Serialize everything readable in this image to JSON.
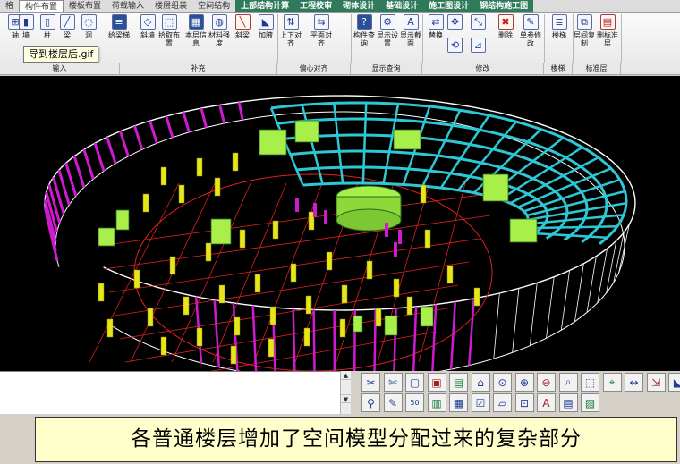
{
  "tabs": [
    "格",
    "构件布置",
    "楼板布置",
    "荷载输入",
    "楼层组装",
    "空间结构",
    "上部结构计算",
    "工程校审",
    "砌体设计",
    "基础设计",
    "施工图设计",
    "钢结构施工图"
  ],
  "active_tab_index": 1,
  "ribbon": {
    "tools": [
      {
        "label": "轴",
        "icon": "axis-icon"
      },
      {
        "label": "墙",
        "icon": "wall-icon"
      },
      {
        "label": "柱",
        "icon": "column-icon"
      },
      {
        "label": "梁",
        "icon": "beam-icon"
      },
      {
        "label": "洞",
        "icon": "opening-icon"
      },
      {
        "label": "给梁梯",
        "icon": "stair-beam-icon"
      },
      {
        "label": "斜墙",
        "icon": "slant-wall-icon"
      },
      {
        "label": "拾取布置",
        "icon": "pick-layout-icon"
      },
      {
        "label": "本层信息",
        "icon": "floor-info-icon"
      },
      {
        "label": "材料强度",
        "icon": "material-strength-icon"
      },
      {
        "label": "斜梁",
        "icon": "slant-beam-icon"
      },
      {
        "label": "加腋",
        "icon": "haunch-icon"
      },
      {
        "label": "上下对齐",
        "icon": "align-vertical-icon"
      },
      {
        "label": "平面对齐",
        "icon": "align-plane-icon"
      },
      {
        "label": "构件查询",
        "icon": "member-query-icon"
      },
      {
        "label": "显示设置",
        "icon": "display-settings-icon"
      },
      {
        "label": "显示截面",
        "icon": "display-section-icon"
      },
      {
        "label": "替换",
        "icon": "replace-icon"
      },
      {
        "label": "删除",
        "icon": "delete-icon"
      },
      {
        "label": "单参修改",
        "icon": "param-edit-icon"
      },
      {
        "label": "楼梯",
        "icon": "stairs-icon"
      },
      {
        "label": "层间复制",
        "icon": "floor-copy-icon"
      },
      {
        "label": "删标准层",
        "icon": "delete-std-floor-icon"
      }
    ],
    "groups": [
      "输入",
      "补充",
      "偏心对齐",
      "显示查询",
      "修改",
      "楼梯",
      "标准层"
    ],
    "tooltip": "导到楼层后.gif"
  },
  "colors": {
    "beams": "#2ec7d4",
    "slabs": "#a8ef4a",
    "braces": "#d01ad0",
    "columns": "#e6e61a",
    "gridlines": "#e02020",
    "wireframe": "#ffffff",
    "caption_bg": "#ffffcc"
  },
  "caption": "各普通楼层增加了空间模型分配过来的复杂部分"
}
